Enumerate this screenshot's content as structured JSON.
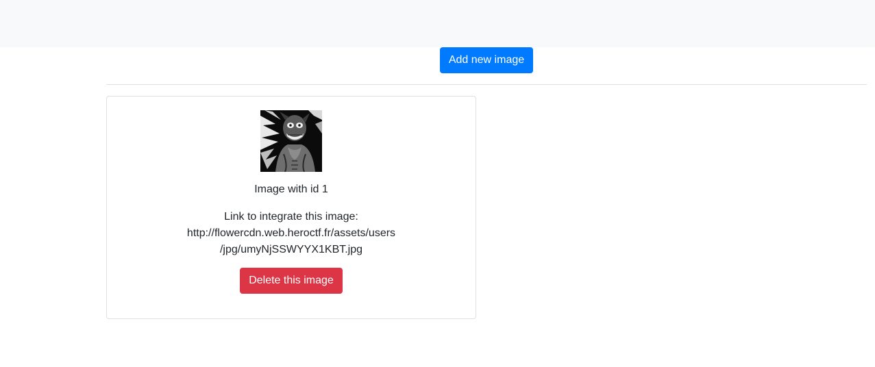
{
  "header": {
    "background": "#f8f9fa"
  },
  "toolbar": {
    "add_label": "Add new image",
    "add_color": "#007bff"
  },
  "images": [
    {
      "caption": "Image with id 1",
      "link_label": "Link to integrate this image:",
      "link_line1": "http://flowercdn.web.heroctf.fr/assets/users",
      "link_line2": "/jpg/umyNjSSWYYX1KBT.jpg",
      "delete_label": "Delete this image",
      "delete_color": "#dc3545",
      "thumbnail_icon": "grayscale-creature-thumbnail"
    }
  ]
}
